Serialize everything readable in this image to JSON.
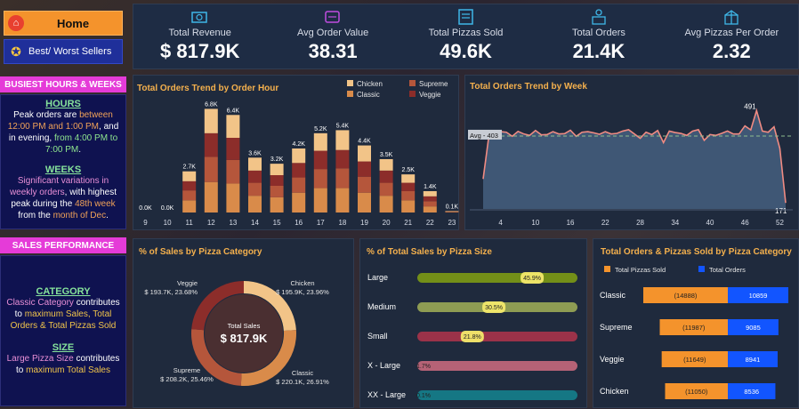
{
  "nav": {
    "home": "Home",
    "best_worst": "Best/ Worst Sellers"
  },
  "busiest": {
    "header": "BUSIEST HOURS & WEEKS",
    "hours_title": "HOURS",
    "hours_text_1": "Peak orders are ",
    "hours_text_2": "between 12:00 PM and 1:00 PM",
    "hours_text_3": ", and in evening, ",
    "hours_text_4": "from 4:00 PM to 7:00 PM",
    "hours_text_5": ".",
    "weeks_title": "WEEKS",
    "weeks_text_1": "Significant variations in weekly orders",
    "weeks_text_2": ", with highest peak during the ",
    "weeks_text_3": "48th week",
    "weeks_text_4": " from the ",
    "weeks_text_5": "month of Dec",
    "weeks_text_6": "."
  },
  "sales_perf": {
    "header": "SALES PERFORMANCE",
    "category_title": "CATEGORY",
    "category_text_1": "Classic Category",
    "category_text_2": " contributes to ",
    "category_text_3": "maximum Sales, Total Orders & Total Pizzas Sold",
    "size_title": "SIZE",
    "size_text_1": "Large Pizza Size",
    "size_text_2": " contributes to ",
    "size_text_3": "maximum Total Sales"
  },
  "kpis": [
    {
      "title": "Total Revenue",
      "value": "$ 817.9K",
      "icon": "money-icon"
    },
    {
      "title": "Avg Order Value",
      "value": "38.31",
      "icon": "ticket-icon"
    },
    {
      "title": "Total Pizzas Sold",
      "value": "49.6K",
      "icon": "pizza-box-icon"
    },
    {
      "title": "Total Orders",
      "value": "21.4K",
      "icon": "delivery-icon"
    },
    {
      "title": "Avg Pizzas Per Order",
      "value": "2.32",
      "icon": "gift-box-icon"
    }
  ],
  "colors": {
    "classic": "#d98b4a",
    "chicken": "#f2c488",
    "supreme": "#b5563b",
    "veggie": "#8c2d2a",
    "accent": "#f4b04d",
    "orders_blue": "#1255ff",
    "pizzas_orange": "#f4932c"
  },
  "chart_data": [
    {
      "type": "bar",
      "title": "Total Orders Trend by Order Hour",
      "categories": [
        "9",
        "10",
        "11",
        "12",
        "13",
        "14",
        "15",
        "16",
        "17",
        "18",
        "19",
        "20",
        "21",
        "22",
        "23"
      ],
      "totals_labels": [
        "0.0K",
        "0.0K",
        "2.7K",
        "6.8K",
        "6.4K",
        "3.6K",
        "3.2K",
        "4.2K",
        "5.2K",
        "5.4K",
        "4.4K",
        "3.5K",
        "2.5K",
        "1.4K",
        "0.1K"
      ],
      "series": [
        {
          "name": "Classic",
          "values": [
            0.0,
            0.0,
            0.8,
            2.0,
            1.9,
            1.1,
            1.0,
            1.3,
            1.6,
            1.6,
            1.3,
            1.1,
            0.8,
            0.4,
            0.03
          ]
        },
        {
          "name": "Supreme",
          "values": [
            0.0,
            0.0,
            0.65,
            1.65,
            1.55,
            0.85,
            0.75,
            1.0,
            1.25,
            1.3,
            1.05,
            0.85,
            0.6,
            0.34,
            0.02
          ]
        },
        {
          "name": "Veggie",
          "values": [
            0.0,
            0.0,
            0.6,
            1.55,
            1.45,
            0.8,
            0.7,
            0.95,
            1.2,
            1.2,
            1.0,
            0.8,
            0.55,
            0.32,
            0.02
          ]
        },
        {
          "name": "Chicken",
          "values": [
            0.0,
            0.0,
            0.65,
            1.6,
            1.5,
            0.85,
            0.75,
            0.95,
            1.15,
            1.3,
            1.05,
            0.75,
            0.55,
            0.34,
            0.03
          ]
        }
      ],
      "legend": [
        "Chicken",
        "Supreme",
        "Classic",
        "Veggie"
      ]
    },
    {
      "type": "area",
      "title": "Total Orders Trend by Week",
      "x_ticks": [
        "4",
        "10",
        "16",
        "22",
        "28",
        "34",
        "40",
        "46",
        "52"
      ],
      "x": [
        1,
        2,
        3,
        4,
        5,
        6,
        7,
        8,
        9,
        10,
        11,
        12,
        13,
        14,
        15,
        16,
        17,
        18,
        19,
        20,
        21,
        22,
        23,
        24,
        25,
        26,
        27,
        28,
        29,
        30,
        31,
        32,
        33,
        34,
        35,
        36,
        37,
        38,
        39,
        40,
        41,
        42,
        43,
        44,
        45,
        46,
        47,
        48,
        49,
        50,
        51,
        52,
        53
      ],
      "values": [
        254,
        405,
        410,
        418,
        416,
        402,
        419,
        410,
        405,
        422,
        407,
        408,
        418,
        410,
        411,
        423,
        402,
        416,
        418,
        414,
        409,
        418,
        410,
        412,
        420,
        425,
        410,
        395,
        416,
        408,
        422,
        380,
        420,
        415,
        412,
        405,
        420,
        425,
        388,
        408,
        405,
        412,
        420,
        410,
        410,
        438,
        424,
        491,
        420,
        416,
        435,
        360,
        171
      ],
      "avg_label": "Avg - 403",
      "avg": 403,
      "annotations": [
        "491",
        "171"
      ],
      "ylim": [
        150,
        520
      ]
    },
    {
      "type": "pie",
      "title": "% of Sales by Pizza Category",
      "center_label": "Total Sales",
      "center_value": "$ 817.9K",
      "slices": [
        {
          "name": "Classic",
          "value": 26.91,
          "label_1": "Classic",
          "label_2": "$ 220.1K, 26.91%"
        },
        {
          "name": "Supreme",
          "value": 25.46,
          "label_1": "Supreme",
          "label_2": "$ 208.2K, 25.46%"
        },
        {
          "name": "Veggie",
          "value": 23.68,
          "label_1": "Veggie",
          "label_2": "$ 193.7K, 23.68%"
        },
        {
          "name": "Chicken",
          "value": 23.96,
          "label_1": "Chicken",
          "label_2": "$ 195.9K, 23.96%"
        }
      ]
    },
    {
      "type": "bar",
      "title": "% of Total Sales by Pizza Size",
      "categories": [
        "Large",
        "Medium",
        "Small",
        "X - Large",
        "XX - Large"
      ],
      "values": [
        45.9,
        30.5,
        21.8,
        1.7,
        0.1
      ],
      "labels": [
        "45.9%",
        "30.5%",
        "21.8%",
        "1.7%",
        "0.1%"
      ],
      "colors": [
        "#7c9a14",
        "#9aa855",
        "#a8334a",
        "#c5687c",
        "#147f8c"
      ],
      "track_colors": [
        "#7c9a14",
        "#9aa855",
        "#a8334a",
        "#c5687c",
        "#147f8c"
      ]
    },
    {
      "type": "bar",
      "title": "Total Orders & Pizzas Sold by Pizza Category",
      "legend": [
        "Total Pizzas Sold",
        "Total Orders"
      ],
      "categories": [
        "Classic",
        "Supreme",
        "Veggie",
        "Chicken"
      ],
      "series": [
        {
          "name": "Total Pizzas Sold",
          "values": [
            14888,
            11987,
            11649,
            11050
          ],
          "labels": [
            "(14888)",
            "(11987)",
            "(11649)",
            "(11050)"
          ]
        },
        {
          "name": "Total Orders",
          "values": [
            10859,
            9085,
            8941,
            8536
          ],
          "labels": [
            "10859",
            "9085",
            "8941",
            "8536"
          ]
        }
      ]
    }
  ]
}
